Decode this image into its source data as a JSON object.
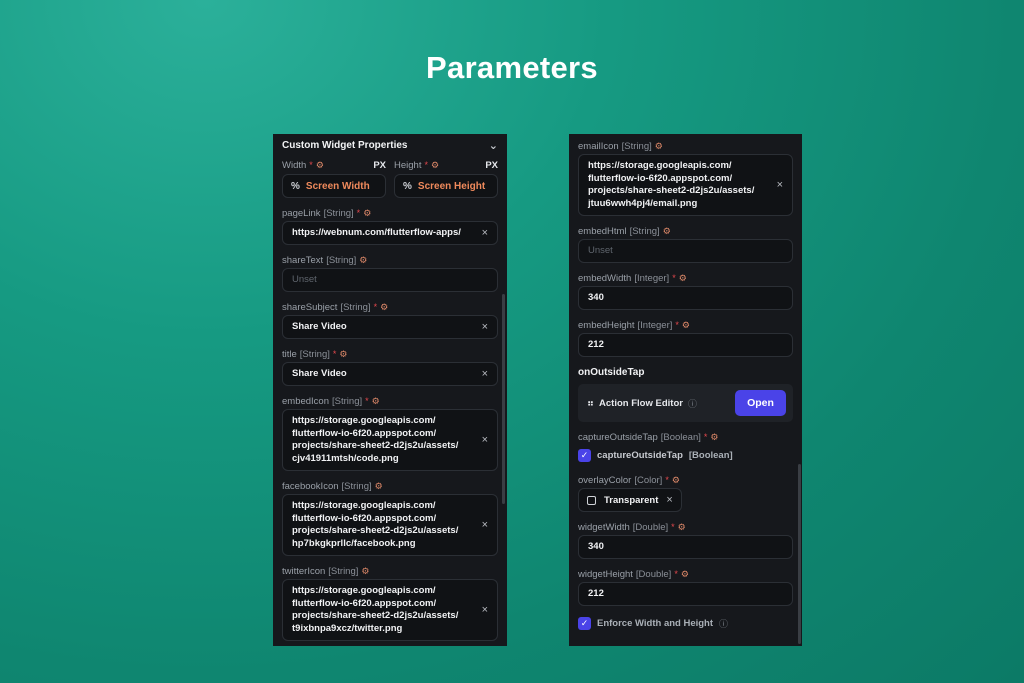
{
  "page": {
    "title": "Parameters"
  },
  "left": {
    "header": "Custom Widget Properties",
    "width_label": "Width",
    "height_label": "Height",
    "px": "PX",
    "screen_width": "Screen Width",
    "screen_height": "Screen Height",
    "pct_symbol": "%",
    "pageLink": {
      "name": "pageLink",
      "type": "[String]",
      "value": "https://webnum.com/flutterflow-apps/"
    },
    "shareText": {
      "name": "shareText",
      "type": "[String]",
      "placeholder": "Unset"
    },
    "shareSubject": {
      "name": "shareSubject",
      "type": "[String]",
      "value": "Share Video"
    },
    "title": {
      "name": "title",
      "type": "[String]",
      "value": "Share Video"
    },
    "embedIcon": {
      "name": "embedIcon",
      "type": "[String]",
      "lines": [
        "https://storage.googleapis.com/",
        "flutterflow-io-6f20.appspot.com/",
        "projects/share-sheet2-d2js2u/assets/",
        "cjv41911mtsh/code.png"
      ]
    },
    "facebookIcon": {
      "name": "facebookIcon",
      "type": "[String]",
      "lines": [
        "https://storage.googleapis.com/",
        "flutterflow-io-6f20.appspot.com/",
        "projects/share-sheet2-d2js2u/assets/",
        "hp7bkgkprllc/facebook.png"
      ]
    },
    "twitterIcon": {
      "name": "twitterIcon",
      "type": "[String]",
      "lines": [
        "https://storage.googleapis.com/",
        "flutterflow-io-6f20.appspot.com/",
        "projects/share-sheet2-d2js2u/assets/",
        "t9ixbnpa9xcz/twitter.png"
      ]
    }
  },
  "right": {
    "emailIcon": {
      "name": "emailIcon",
      "type": "[String]",
      "lines": [
        "https://storage.googleapis.com/",
        "flutterflow-io-6f20.appspot.com/",
        "projects/share-sheet2-d2js2u/assets/",
        "jtuu6wwh4pj4/email.png"
      ]
    },
    "embedHtml": {
      "name": "embedHtml",
      "type": "[String]",
      "placeholder": "Unset"
    },
    "embedWidth": {
      "name": "embedWidth",
      "type": "[Integer]",
      "value": "340"
    },
    "embedHeight": {
      "name": "embedHeight",
      "type": "[Integer]",
      "value": "212"
    },
    "onOutsideTap": "onOutsideTap",
    "action_flow_editor": "Action Flow Editor",
    "open_label": "Open",
    "captureOutsideTap": {
      "name": "captureOutsideTap",
      "type": "[Boolean]",
      "check_label": "captureOutsideTap",
      "check_type": "[Boolean]",
      "checked": true
    },
    "overlayColor": {
      "name": "overlayColor",
      "type": "[Color]",
      "value": "Transparent"
    },
    "widgetWidth": {
      "name": "widgetWidth",
      "type": "[Double]",
      "value": "340"
    },
    "widgetHeight": {
      "name": "widgetHeight",
      "type": "[Double]",
      "value": "212"
    },
    "enforce": {
      "label": "Enforce Width and Height",
      "checked": true
    }
  },
  "icons": {
    "close": "×",
    "chevron": "⌄",
    "check": "✓",
    "info": "ⓘ",
    "tune": "⚙"
  },
  "colors": {
    "accent": "#4a43e8",
    "orange": "#ef8a5c",
    "required": "#e5484d",
    "panel": "#16181c"
  }
}
